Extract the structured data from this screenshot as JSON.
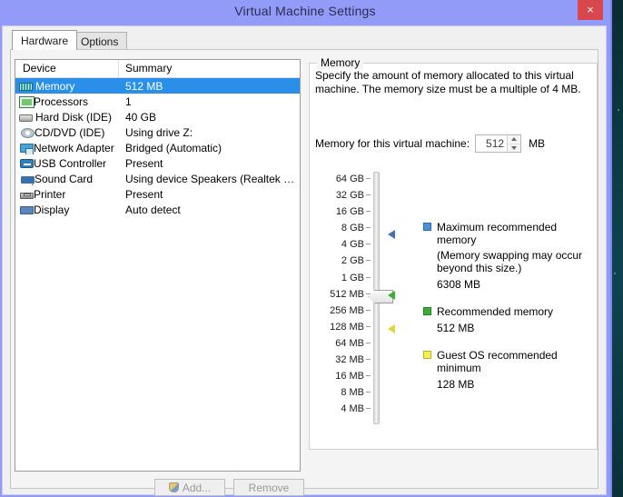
{
  "window": {
    "title": "Virtual Machine Settings",
    "close_label": "×"
  },
  "tabs": [
    {
      "label": "Hardware",
      "active": true
    },
    {
      "label": "Options",
      "active": false
    }
  ],
  "device_list": {
    "columns": [
      "Device",
      "Summary"
    ],
    "rows": [
      {
        "icon": "memory-icon",
        "device": "Memory",
        "summary": "512 MB",
        "selected": true
      },
      {
        "icon": "processor-icon",
        "device": "Processors",
        "summary": "1",
        "selected": false
      },
      {
        "icon": "hard-disk-icon",
        "device": "Hard Disk (IDE)",
        "summary": "40 GB",
        "selected": false
      },
      {
        "icon": "cd-dvd-icon",
        "device": "CD/DVD (IDE)",
        "summary": "Using drive Z:",
        "selected": false
      },
      {
        "icon": "network-adapter-icon",
        "device": "Network Adapter",
        "summary": "Bridged (Automatic)",
        "selected": false
      },
      {
        "icon": "usb-controller-icon",
        "device": "USB Controller",
        "summary": "Present",
        "selected": false
      },
      {
        "icon": "sound-card-icon",
        "device": "Sound Card",
        "summary": "Using device Speakers (Realtek Hi…)",
        "selected": false
      },
      {
        "icon": "printer-icon",
        "device": "Printer",
        "summary": "Present",
        "selected": false
      },
      {
        "icon": "display-icon",
        "device": "Display",
        "summary": "Auto detect",
        "selected": false
      }
    ]
  },
  "buttons": {
    "add_label": "Add...",
    "remove_label": "Remove"
  },
  "memory_panel": {
    "group_title": "Memory",
    "description": "Specify the amount of memory allocated to this virtual machine. The memory size must be a multiple of 4 MB.",
    "field_label": "Memory for this virtual machine:",
    "value": "512",
    "unit": "MB",
    "scale": [
      "64 GB",
      "32 GB",
      "16 GB",
      "8 GB",
      "4 GB",
      "2 GB",
      "1 GB",
      "512 MB",
      "256 MB",
      "128 MB",
      "64 MB",
      "32 MB",
      "16 MB",
      "8 MB",
      "4 MB"
    ],
    "legend": [
      {
        "color": "#4a90d9",
        "swatch_class": "sw-blue",
        "title": "Maximum recommended memory",
        "note": "(Memory swapping may occur beyond this size.)",
        "value": "6308 MB"
      },
      {
        "color": "#3cb034",
        "swatch_class": "sw-green",
        "title": "Recommended memory",
        "note": "",
        "value": "512 MB"
      },
      {
        "color": "#f5f050",
        "swatch_class": "sw-yellow",
        "title": "Guest OS recommended minimum",
        "note": "",
        "value": "128 MB"
      }
    ]
  },
  "colors": {
    "titlebar": "#939bf8",
    "close_button": "#d8474c",
    "selection": "#2a8fe8"
  }
}
